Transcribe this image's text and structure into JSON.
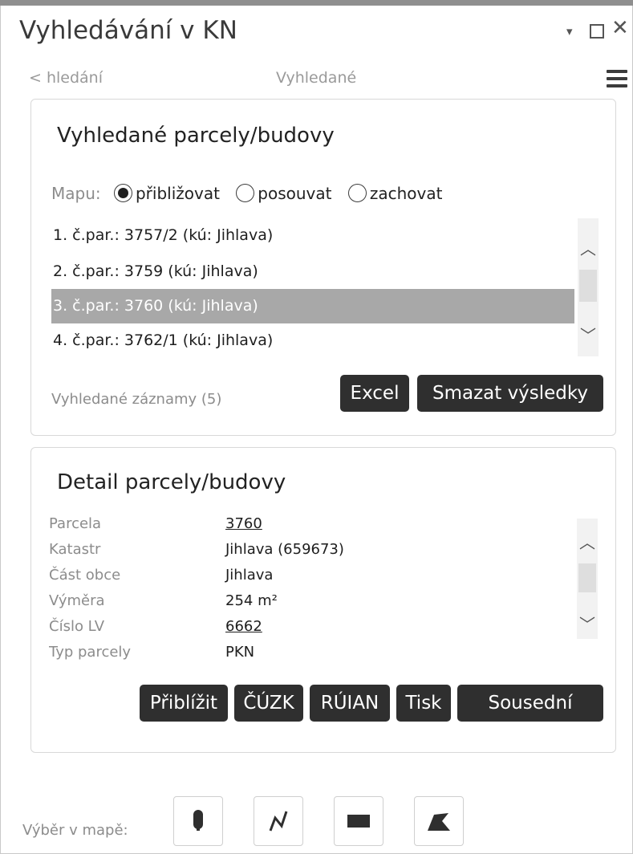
{
  "window": {
    "title": "Vyhledávání v KN",
    "controls": {
      "minimize": "▾",
      "close": "✕"
    }
  },
  "nav": {
    "back_label": "< hledání",
    "current_label": "Vyhledané",
    "menu_icon": "hamburger-menu-icon"
  },
  "results_panel": {
    "title": "Vyhledané parcely/budovy",
    "map_mode_label": "Mapu:",
    "map_modes": [
      {
        "label": "přibližovat",
        "selected": true
      },
      {
        "label": "posouvat",
        "selected": false
      },
      {
        "label": "zachovat",
        "selected": false
      }
    ],
    "items": [
      "1. č.par.: 3757/2 (kú: Jihlava)",
      "2. č.par.: 3759 (kú: Jihlava)",
      "3. č.par.: 3760 (kú: Jihlava)",
      "4. č.par.: 3762/1 (kú: Jihlava)"
    ],
    "selected_index": 2,
    "count_label": "Vyhledané záznamy (5)",
    "buttons": {
      "excel": "Excel",
      "clear": "Smazat výsledky"
    }
  },
  "detail_panel": {
    "title": "Detail parcely/budovy",
    "rows": [
      {
        "label": "Parcela",
        "value": "3760",
        "link": true
      },
      {
        "label": "Katastr",
        "value": "Jihlava (659673)",
        "link": false
      },
      {
        "label": "Část obce",
        "value": "Jihlava",
        "link": false
      },
      {
        "label": "Výměra",
        "value": "254 m²",
        "link": false
      },
      {
        "label": "Číslo LV",
        "value": "6662",
        "link": true
      },
      {
        "label": "Typ parcely",
        "value": "PKN",
        "link": false
      }
    ],
    "buttons": {
      "zoom": "Přiblížit",
      "cuzk": "ČÚZK",
      "ruian": "RÚIAN",
      "print": "Tisk",
      "neighbors": "Sousední"
    }
  },
  "map_selection": {
    "label": "Výběr v mapě:",
    "tools": [
      "point-tool-icon",
      "polyline-tool-icon",
      "rectangle-tool-icon",
      "polygon-tool-icon"
    ]
  }
}
